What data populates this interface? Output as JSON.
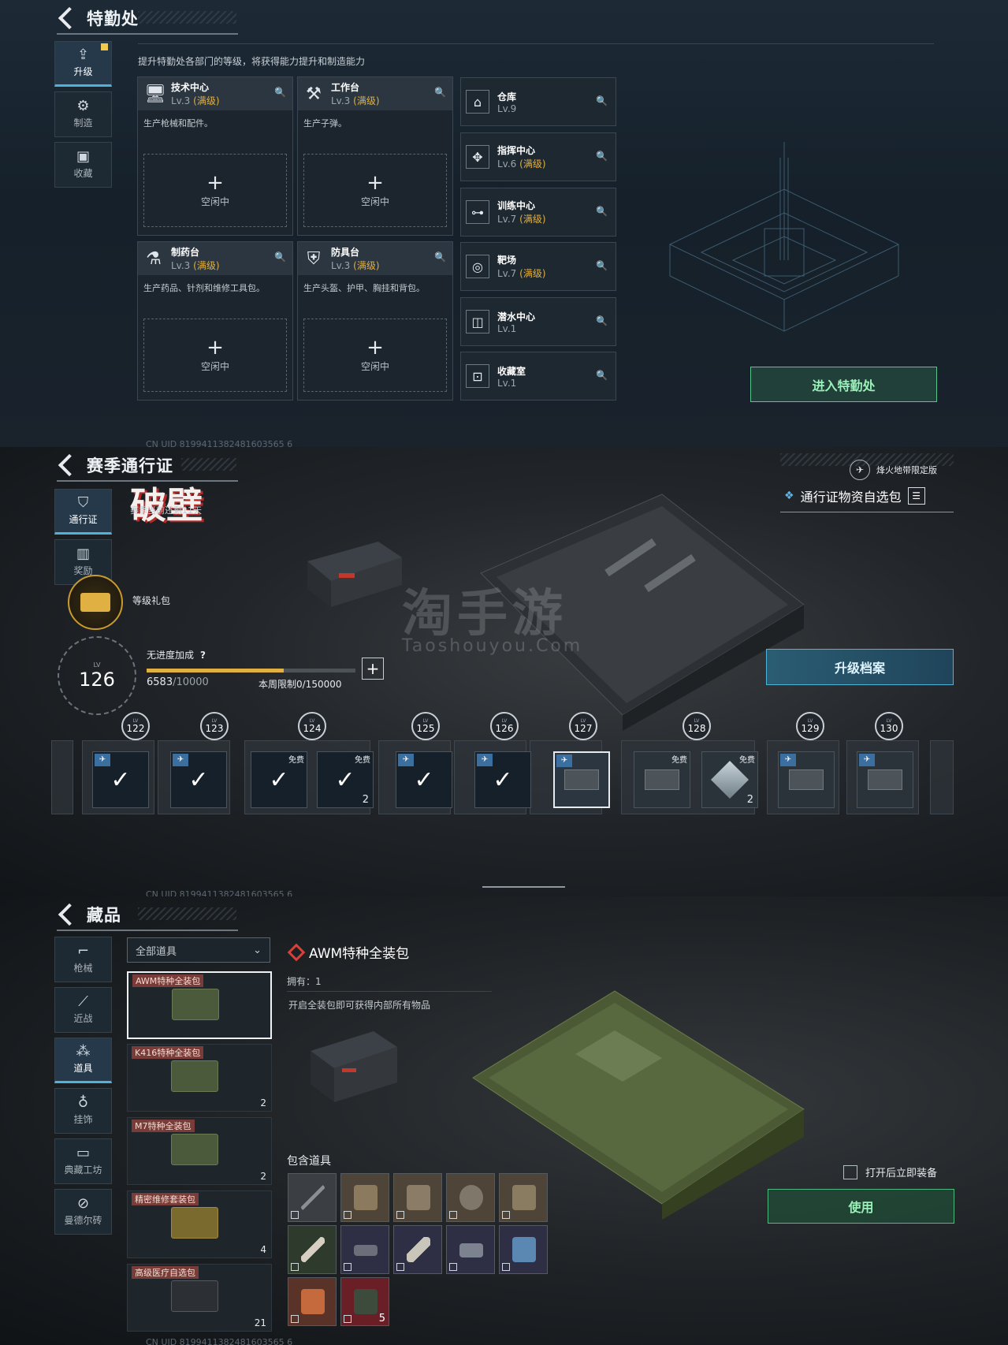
{
  "panel1": {
    "title": "特勤处",
    "sidebar": [
      {
        "label": "升级",
        "icon": "upgrade-icon",
        "active": true
      },
      {
        "label": "制造",
        "icon": "gears-icon",
        "active": false
      },
      {
        "label": "收藏",
        "icon": "collection-icon",
        "active": false
      }
    ],
    "description": "提升特勤处各部门的等级，将获得能力提升和制造能力",
    "cards": [
      {
        "name": "技术中心",
        "level": "Lv.3",
        "max": "(满级)",
        "desc": "生产枪械和配件。",
        "slot": "空闲中",
        "icon": "monitor-icon"
      },
      {
        "name": "工作台",
        "level": "Lv.3",
        "max": "(满级)",
        "desc": "生产子弹。",
        "slot": "空闲中",
        "icon": "tools-icon"
      },
      {
        "name": "制药台",
        "level": "Lv.3",
        "max": "(满级)",
        "desc": "生产药品、针剂和维修工具包。",
        "slot": "空闲中",
        "icon": "pharmacy-icon"
      },
      {
        "name": "防具台",
        "level": "Lv.3",
        "max": "(满级)",
        "desc": "生产头盔、护甲、胸挂和背包。",
        "slot": "空闲中",
        "icon": "armor-icon"
      }
    ],
    "facilities": [
      {
        "name": "仓库",
        "level": "Lv.9",
        "max": "",
        "icon": "warehouse-icon"
      },
      {
        "name": "指挥中心",
        "level": "Lv.6",
        "max": "(满级)",
        "icon": "command-icon"
      },
      {
        "name": "训练中心",
        "level": "Lv.7",
        "max": "(满级)",
        "icon": "dumbbell-icon"
      },
      {
        "name": "靶场",
        "level": "Lv.7",
        "max": "(满级)",
        "icon": "target-icon"
      },
      {
        "name": "潜水中心",
        "level": "Lv.1",
        "max": "",
        "icon": "diving-icon"
      },
      {
        "name": "收藏室",
        "level": "Lv.1",
        "max": "",
        "icon": "vault-icon"
      }
    ],
    "enter_button": "进入特勤处",
    "footer": "CN UID 8199411382481603565 6"
  },
  "panel2": {
    "title": "赛季通行证",
    "sidebar": [
      {
        "label": "通行证",
        "icon": "pass-icon",
        "active": true
      },
      {
        "label": "奖励",
        "icon": "gift-icon",
        "active": false
      }
    ],
    "season_logo": "破壁",
    "season_remaining": "赛季当前还剩11天",
    "limited_label": "烽火地带限定版",
    "select_pack": "通行证物资自选包",
    "watermark": "淘手游",
    "watermark_sub": "Taoshouyou.Com",
    "gift_label": "等级礼包",
    "level_caption": "LV",
    "level": "126",
    "no_progress_bonus": "无进度加成",
    "help_mark": "?",
    "xp_current": "6583",
    "xp_total": "/10000",
    "xp_fraction": 0.6583,
    "weekly_limit": "本周限制0/150000",
    "upgrade_button": "升级档案",
    "levels": [
      "122",
      "123",
      "124",
      "125",
      "126",
      "127",
      "128",
      "129",
      "130"
    ],
    "free_label": "免费",
    "lv_small": "LV",
    "count_2": "2",
    "footer": "CN UID 8199411382481603565 6"
  },
  "panel3": {
    "title": "藏品",
    "sidebar": [
      {
        "label": "枪械",
        "icon": "gun-icon",
        "active": false
      },
      {
        "label": "近战",
        "icon": "knife-icon",
        "active": false
      },
      {
        "label": "道具",
        "icon": "items-icon",
        "active": true
      },
      {
        "label": "挂饰",
        "icon": "charm-icon",
        "active": false
      },
      {
        "label": "典藏工坊",
        "icon": "workshop-icon",
        "active": false
      },
      {
        "label": "曼德尔砖",
        "icon": "brick-icon",
        "active": false
      }
    ],
    "category": "全部道具",
    "items": [
      {
        "name": "AWM特种全装包",
        "count": ""
      },
      {
        "name": "K416特种全装包",
        "count": "2"
      },
      {
        "name": "M7特种全装包",
        "count": "2"
      },
      {
        "name": "精密维修套装包",
        "count": "4"
      },
      {
        "name": "高级医疗自选包",
        "count": "21"
      }
    ],
    "selected_title": "AWM特种全装包",
    "owned": "拥有：1",
    "description": "开启全装包即可获得内部所有物品",
    "included_label": "包含道具",
    "included_last_count": "5",
    "auto_equip": "打开后立即装备",
    "use_button": "使用",
    "footer": "CN UID 8199411382481603565 6"
  }
}
